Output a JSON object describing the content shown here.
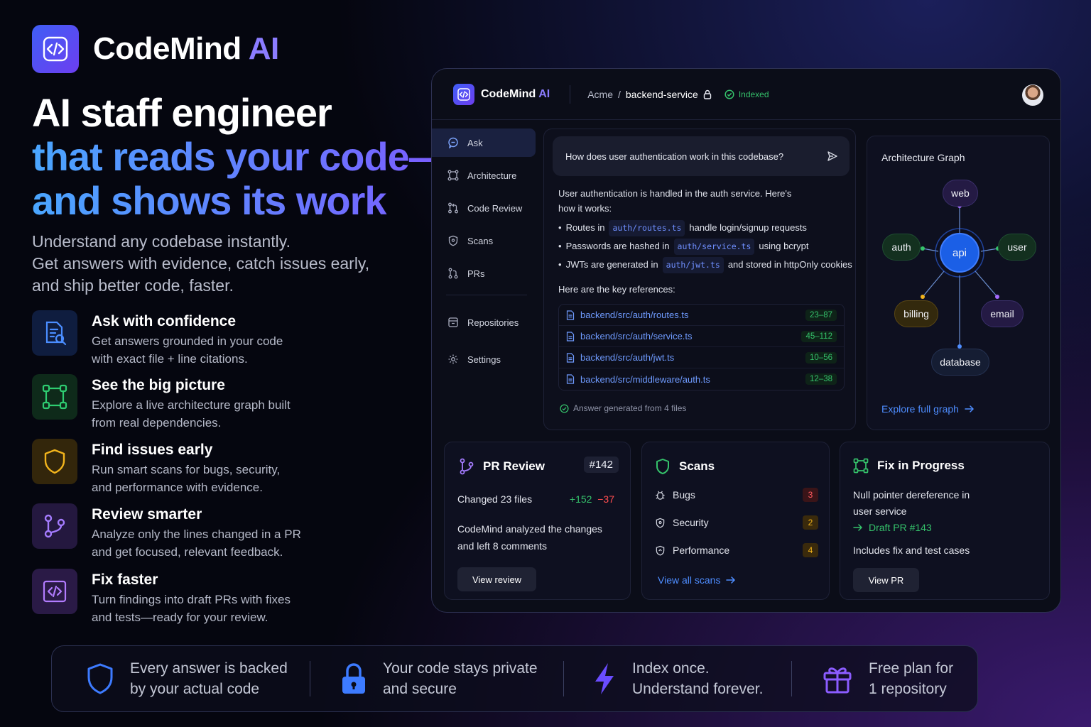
{
  "brand": {
    "name_main": "CodeMind",
    "name_ai": "AI"
  },
  "headline": {
    "line1": "AI staff engineer",
    "line2": "that reads your code—",
    "line3": "and shows its work"
  },
  "subtitle": {
    "line1": "Understand any codebase instantly.",
    "line2": "Get answers with evidence, catch issues early,",
    "line3": "and ship better code, faster."
  },
  "features": [
    {
      "title": "Ask with confidence",
      "line1": "Get answers grounded in your code",
      "line2": "with exact file + line citations.",
      "icon": "document-search-icon"
    },
    {
      "title": "See the big picture",
      "line1": "Explore a live architecture graph built",
      "line2": "from real dependencies.",
      "icon": "graph-icon"
    },
    {
      "title": "Find issues early",
      "line1": "Run smart scans for bugs, security,",
      "line2": "and performance with evidence.",
      "icon": "shield-icon"
    },
    {
      "title": "Review smarter",
      "line1": "Analyze only the lines changed in a PR",
      "line2": "and get focused, relevant feedback.",
      "icon": "branch-icon"
    },
    {
      "title": "Fix faster",
      "line1": "Turn findings into draft PRs with fixes",
      "line2": "and tests—ready for your review.",
      "icon": "code-file-icon"
    }
  ],
  "app": {
    "name_main": "CodeMind",
    "name_ai": "AI",
    "breadcrumb": {
      "org": "Acme",
      "sep": "/",
      "repo": "backend-service"
    },
    "status": "Indexed",
    "nav": [
      {
        "label": "Ask",
        "icon": "chat-icon",
        "active": true
      },
      {
        "label": "Architecture",
        "icon": "nodes-icon"
      },
      {
        "label": "Code Review",
        "icon": "review-icon"
      },
      {
        "label": "Scans",
        "icon": "shield-icon"
      },
      {
        "label": "PRs",
        "icon": "pr-icon"
      },
      {
        "label": "Repositories",
        "icon": "repo-icon"
      },
      {
        "label": "Settings",
        "icon": "gear-icon"
      }
    ],
    "ask": {
      "question": "How does user authentication work in this codebase?",
      "intro_line1": "User authentication is handled in the auth service. Here's",
      "intro_line2": "how it works:",
      "bullets": [
        {
          "pre": "Routes in",
          "code": "auth/routes.ts",
          "post": "handle login/signup requests"
        },
        {
          "pre": "Passwords are hashed in",
          "code": "auth/service.ts",
          "post": "using bcrypt"
        },
        {
          "pre": "JWTs are generated in",
          "code": "auth/jwt.ts",
          "post": "and stored in httpOnly cookies"
        }
      ],
      "refs_heading": "Here are the key references:",
      "refs": [
        {
          "path": "backend/src/auth/routes.ts",
          "lines": "23–87"
        },
        {
          "path": "backend/src/auth/service.ts",
          "lines": "45–112"
        },
        {
          "path": "backend/src/auth/jwt.ts",
          "lines": "10–56"
        },
        {
          "path": "backend/src/middleware/auth.ts",
          "lines": "12–38"
        }
      ],
      "footer": "Answer generated from 4 files"
    },
    "graph": {
      "title": "Architecture Graph",
      "nodes": {
        "web": "web",
        "auth": "auth",
        "api": "api",
        "user": "user",
        "billing": "billing",
        "email": "email",
        "database": "database"
      },
      "explore": "Explore full graph"
    },
    "pr_review": {
      "title": "PR Review",
      "number": "#142",
      "changed": "Changed 23 files",
      "added": "+152",
      "removed": "−37",
      "desc_line1": "CodeMind analyzed the changes",
      "desc_line2": "and left 8 comments",
      "button": "View review"
    },
    "scans": {
      "title": "Scans",
      "rows": [
        {
          "label": "Bugs",
          "count": "3",
          "color": "#e5484d"
        },
        {
          "label": "Security",
          "count": "2",
          "color": "#e5a53a"
        },
        {
          "label": "Performance",
          "count": "4",
          "color": "#e5a53a"
        }
      ],
      "link": "View all scans"
    },
    "fix": {
      "title": "Fix in Progress",
      "line1": "Null pointer dereference in",
      "line2": "user service",
      "draft": "Draft PR #143",
      "includes": "Includes fix and test cases",
      "button": "View PR"
    }
  },
  "bottom": [
    {
      "line1": "Every answer is backed",
      "line2": "by your actual code",
      "icon": "shield-icon"
    },
    {
      "line1": "Your code stays private",
      "line2": "and secure",
      "icon": "lock-icon"
    },
    {
      "line1": "Index once.",
      "line2": "Understand forever.",
      "icon": "bolt-icon"
    },
    {
      "line1": "Free plan for",
      "line2": "1 repository",
      "icon": "gift-icon"
    }
  ]
}
